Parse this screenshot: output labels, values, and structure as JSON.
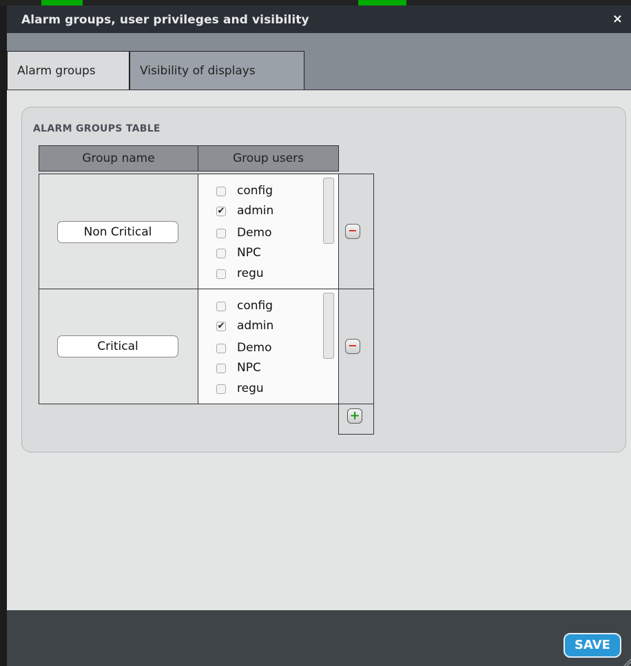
{
  "dialog": {
    "title": "Alarm groups, user privileges and visibility",
    "close_label": "×"
  },
  "tabs": [
    {
      "label": "Alarm groups",
      "active": true
    },
    {
      "label": "Visibility of displays",
      "active": false
    }
  ],
  "panel": {
    "title": "ALARM GROUPS TABLE",
    "columns": [
      "Group name",
      "Group users"
    ]
  },
  "groups": [
    {
      "name": "Non Critical",
      "users": [
        {
          "label": "config",
          "checked": false
        },
        {
          "label": "admin",
          "checked": true
        },
        {
          "label": "Demo",
          "checked": false
        },
        {
          "label": "NPC",
          "checked": false
        },
        {
          "label": "regu",
          "checked": false
        }
      ],
      "remove_label": "−"
    },
    {
      "name": "Critical",
      "users": [
        {
          "label": "config",
          "checked": false
        },
        {
          "label": "admin",
          "checked": true
        },
        {
          "label": "Demo",
          "checked": false
        },
        {
          "label": "NPC",
          "checked": false
        },
        {
          "label": "regu",
          "checked": false
        }
      ],
      "remove_label": "−"
    }
  ],
  "add_label": "+",
  "footer": {
    "save_label": "SAVE"
  },
  "colors": {
    "titlebar": "#2b3036",
    "tabbar": "#858c94",
    "save_button": "#2a98d6",
    "add_icon": "#1a9a1a",
    "remove_icon": "#d22222"
  }
}
